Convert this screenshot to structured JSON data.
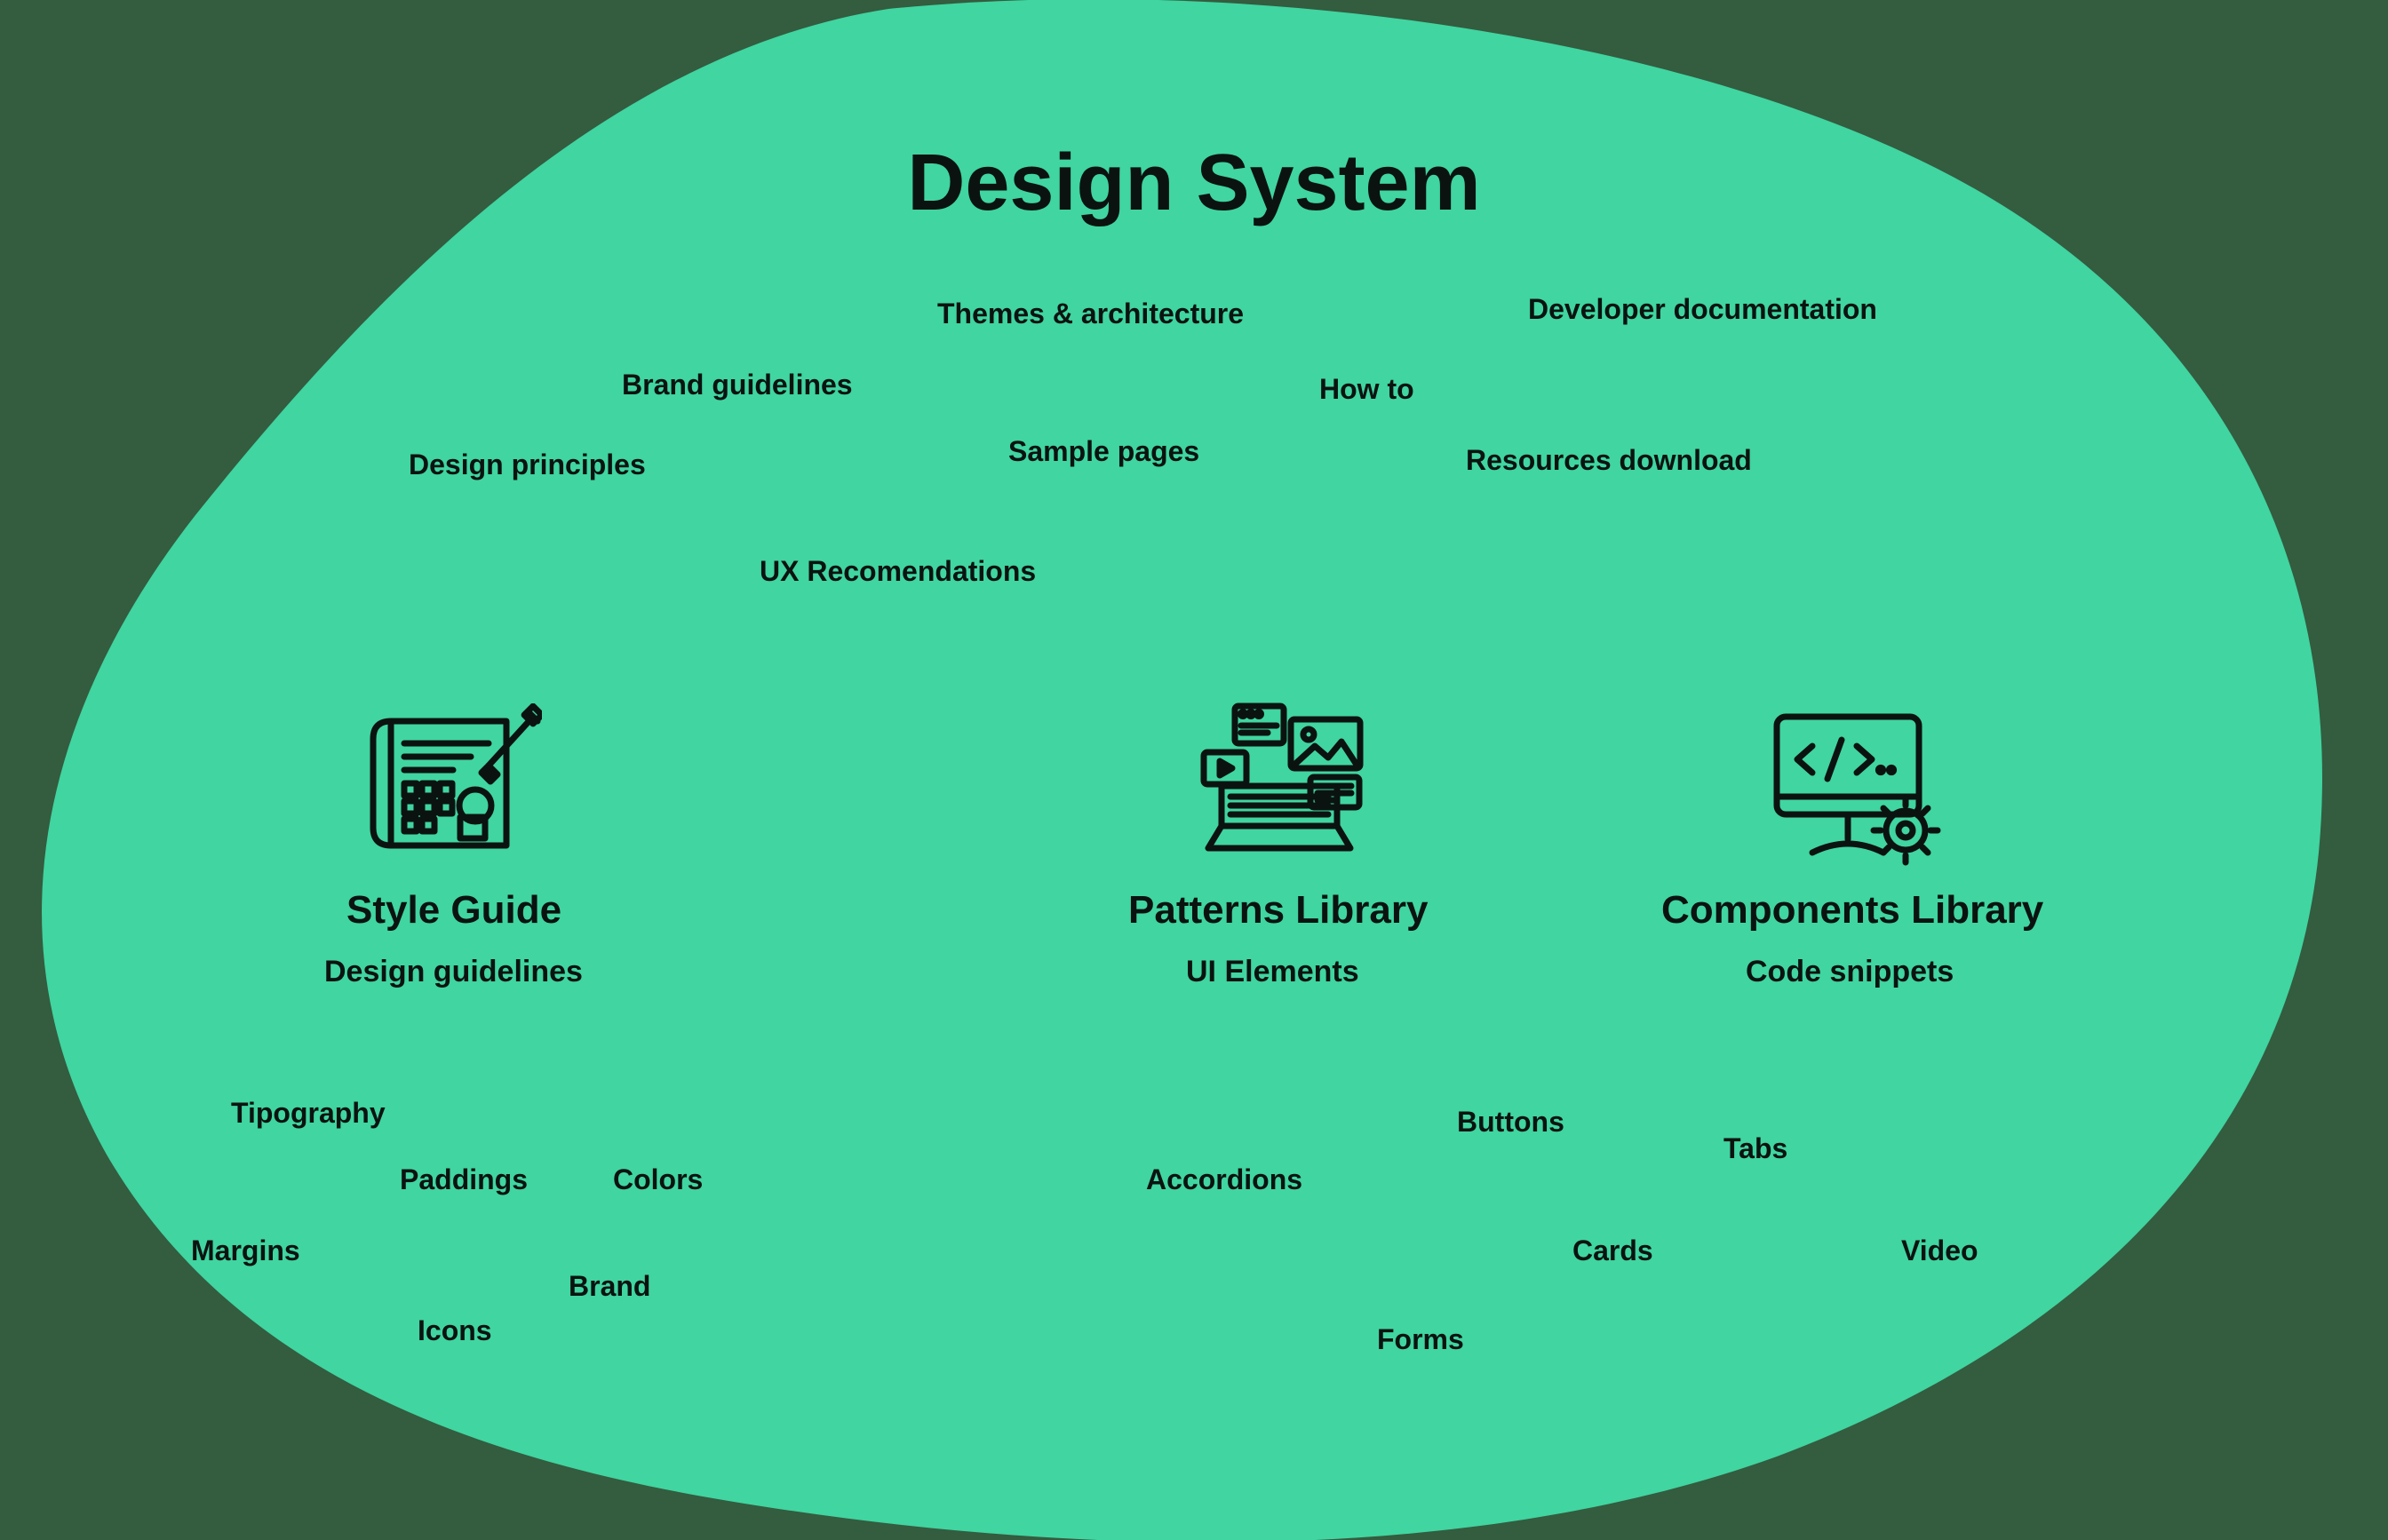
{
  "title": "Design System",
  "top_tags": {
    "design_principles": "Design principles",
    "brand_guidelines": "Brand guidelines",
    "themes_arch": "Themes & architecture",
    "sample_pages": "Sample pages",
    "ux_recs": "UX Recomendations",
    "how_to": "How to",
    "dev_docs": "Developer documentation",
    "resources_dl": "Resources download"
  },
  "sections": {
    "style_guide": {
      "title": "Style Guide",
      "subtitle": "Design guidelines",
      "items": {
        "tipography": "Tipography",
        "paddings": "Paddings",
        "colors": "Colors",
        "margins": "Margins",
        "brand": "Brand",
        "icons": "Icons"
      }
    },
    "patterns": {
      "title": "Patterns Library",
      "subtitle": "UI Elements",
      "items": {
        "accordions": "Accordions",
        "buttons": "Buttons",
        "forms": "Forms",
        "cards": "Cards"
      }
    },
    "components": {
      "title": "Components Library",
      "subtitle": "Code snippets",
      "items": {
        "tabs": "Tabs",
        "video": "Video"
      }
    }
  },
  "colors": {
    "bg": "#345c3f",
    "blob": "#40d5a1",
    "ink": "#0b1310"
  }
}
